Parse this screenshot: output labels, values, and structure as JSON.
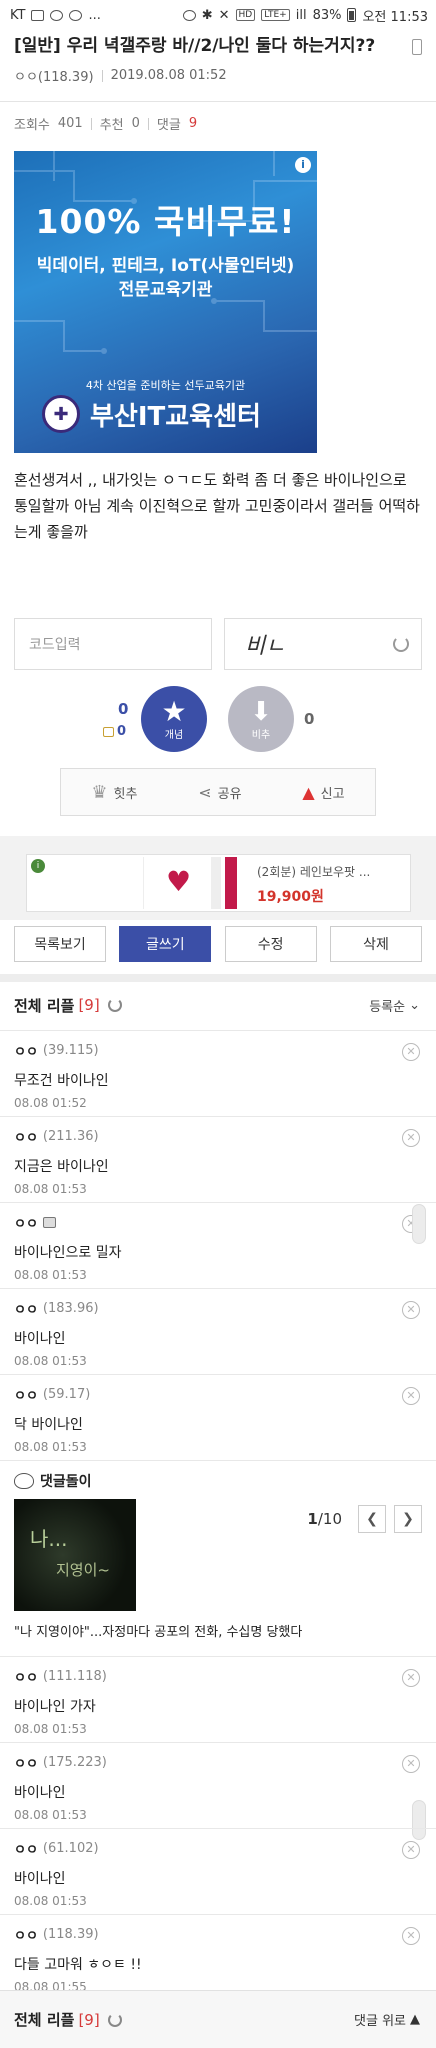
{
  "status": {
    "carrier": "KT",
    "more": "...",
    "lte": "LTE+",
    "signal": "ill",
    "battery": "83%",
    "time": "오전 11:53",
    "hd": "HD"
  },
  "post": {
    "title": "[일반] 우리 녁갤주랑 바//2/나인 둘다 하는거지??",
    "author": "ㅇㅇ(118.39)",
    "date": "2019.08.08 01:52",
    "views_label": "조회수",
    "views": "401",
    "recommend_label": "추천",
    "recommend": "0",
    "reply_label": "댓글",
    "reply": "9",
    "body": "혼선생겨서 ,, 내가잇는 ㅇㄱㄷ도 화력 좀 더 좋은 바이나인으로 통일할까 아님 계속 이진혁으로 할까 고민중이라서 갤러들 어떡하는게 좋을까"
  },
  "ad_banner": {
    "info": "i",
    "headline": "100% 국비무료!",
    "line1": "빅데이터, 핀테크, IoT(사물인터넷)",
    "line2": "전문교육기관",
    "sub": "4차 산업을 준비하는 선두교육기관",
    "brand": "부산IT교육센터"
  },
  "captcha": {
    "placeholder": "코드입력",
    "text": "비ㄴ"
  },
  "votes": {
    "up_count": "0",
    "up_sub": "0",
    "up_label": "개념",
    "down_label": "비추",
    "down_count": "0"
  },
  "actions": {
    "hit": "힛추",
    "share": "공유",
    "report": "신고"
  },
  "ad_strip": {
    "info": "i",
    "name": "(2회분) 레인보우팟 ...",
    "price": "19,900원"
  },
  "buttons": {
    "list": "목록보기",
    "write": "글쓰기",
    "edit": "수정",
    "delete": "삭제"
  },
  "replies_header": {
    "title": "전체 리플",
    "count": "[9]",
    "sort": "등록순"
  },
  "comments": [
    {
      "nick": "ㅇㅇ",
      "ip": "(39.115)",
      "body": "무조건 바이나인",
      "time": "08.08 01:52"
    },
    {
      "nick": "ㅇㅇ",
      "ip": "(211.36)",
      "body": "지금은 바이나인",
      "time": "08.08 01:53"
    },
    {
      "nick": "ㅇㅇ",
      "ip": "",
      "body": "바이나인으로 밀자",
      "time": "08.08 01:53"
    },
    {
      "nick": "ㅇㅇ",
      "ip": "(183.96)",
      "body": "바이나인",
      "time": "08.08 01:53"
    },
    {
      "nick": "ㅇㅇ",
      "ip": "(59.17)",
      "body": "닥 바이나인",
      "time": "08.08 01:53"
    },
    {
      "nick": "ㅇㅇ",
      "ip": "(111.118)",
      "body": "바이나인 가자",
      "time": "08.08 01:53"
    },
    {
      "nick": "ㅇㅇ",
      "ip": "(175.223)",
      "body": "바이나인",
      "time": "08.08 01:53"
    },
    {
      "nick": "ㅇㅇ",
      "ip": "(61.102)",
      "body": "바이나인",
      "time": "08.08 01:53"
    },
    {
      "nick": "ㅇㅇ",
      "ip": "(118.39)",
      "body": "다들 고마워 ㅎㅇㅌ !!",
      "time": "08.08 01:55"
    }
  ],
  "bot": {
    "label": "댓글돌이",
    "img_text1": "나...",
    "img_text2": "지영이~",
    "page_current": "1",
    "page_total": "/10",
    "caption": "\"나 지영이야\"...자정마다 공포의 전화, 수십명 당했다"
  },
  "bottom": {
    "title": "전체 리플",
    "count": "[9]",
    "up": "댓글 위로"
  }
}
